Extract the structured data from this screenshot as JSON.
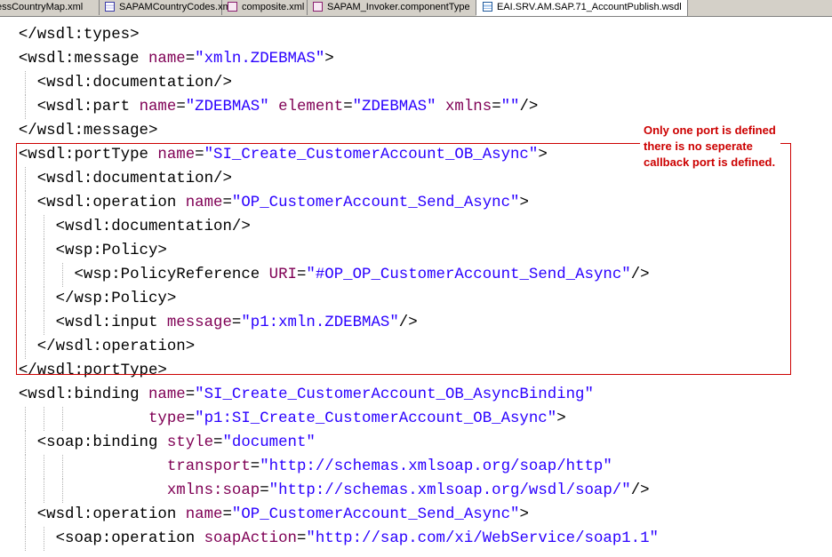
{
  "tabs": [
    {
      "label": "essCountryMap.xml",
      "icon": "xml-file-icon"
    },
    {
      "label": "SAPAMCountryCodes.xml",
      "icon": "xml-file-icon"
    },
    {
      "label": "composite.xml",
      "icon": "composite-file-icon"
    },
    {
      "label": "SAPAM_Invoker.componentType",
      "icon": "component-file-icon"
    },
    {
      "label": "EAI.SRV.AM.SAP.71_AccountPublish.wsdl",
      "icon": "wsdl-file-icon",
      "active": true
    }
  ],
  "annotation": {
    "text": "Only one port is defined there is no seperate callback port is defined.",
    "color": "#cc0000"
  },
  "code_lines": [
    {
      "indent": "  ",
      "segments": [
        [
          "t",
          "</wsdl:types>"
        ]
      ]
    },
    {
      "indent": "  ",
      "segments": [
        [
          "t",
          "<wsdl:message "
        ],
        [
          "n",
          "name"
        ],
        [
          "t",
          "="
        ],
        [
          "v",
          "\"xmln.ZDEBMAS\""
        ],
        [
          "t",
          ">"
        ]
      ]
    },
    {
      "indent": "    ",
      "segments": [
        [
          "t",
          "<wsdl:documentation/>"
        ]
      ]
    },
    {
      "indent": "    ",
      "segments": [
        [
          "t",
          "<wsdl:part "
        ],
        [
          "n",
          "name"
        ],
        [
          "t",
          "="
        ],
        [
          "v",
          "\"ZDEBMAS\""
        ],
        [
          "t",
          " "
        ],
        [
          "n",
          "element"
        ],
        [
          "t",
          "="
        ],
        [
          "v",
          "\"ZDEBMAS\""
        ],
        [
          "t",
          " "
        ],
        [
          "n",
          "xmlns"
        ],
        [
          "t",
          "="
        ],
        [
          "v",
          "\"\""
        ],
        [
          "t",
          "/>"
        ]
      ]
    },
    {
      "indent": "  ",
      "segments": [
        [
          "t",
          "</wsdl:message>"
        ]
      ]
    },
    {
      "indent": "  ",
      "segments": [
        [
          "t",
          "<wsdl:portType "
        ],
        [
          "n",
          "name"
        ],
        [
          "t",
          "="
        ],
        [
          "v",
          "\"SI_Create_CustomerAccount_OB_Async\""
        ],
        [
          "t",
          ">"
        ]
      ]
    },
    {
      "indent": "    ",
      "segments": [
        [
          "t",
          "<wsdl:documentation/>"
        ]
      ]
    },
    {
      "indent": "    ",
      "segments": [
        [
          "t",
          "<wsdl:operation "
        ],
        [
          "n",
          "name"
        ],
        [
          "t",
          "="
        ],
        [
          "v",
          "\"OP_CustomerAccount_Send_Async\""
        ],
        [
          "t",
          ">"
        ]
      ]
    },
    {
      "indent": "      ",
      "segments": [
        [
          "t",
          "<wsdl:documentation/>"
        ]
      ]
    },
    {
      "indent": "      ",
      "segments": [
        [
          "t",
          "<wsp:Policy>"
        ]
      ]
    },
    {
      "indent": "        ",
      "segments": [
        [
          "t",
          "<wsp:PolicyReference "
        ],
        [
          "n",
          "URI"
        ],
        [
          "t",
          "="
        ],
        [
          "v",
          "\"#OP_OP_CustomerAccount_Send_Async\""
        ],
        [
          "t",
          "/>"
        ]
      ]
    },
    {
      "indent": "      ",
      "segments": [
        [
          "t",
          "</wsp:Policy>"
        ]
      ]
    },
    {
      "indent": "      ",
      "segments": [
        [
          "t",
          "<wsdl:input "
        ],
        [
          "n",
          "message"
        ],
        [
          "t",
          "="
        ],
        [
          "v",
          "\"p1:xmln.ZDEBMAS\""
        ],
        [
          "t",
          "/>"
        ]
      ]
    },
    {
      "indent": "    ",
      "segments": [
        [
          "t",
          "</wsdl:operation>"
        ]
      ]
    },
    {
      "indent": "  ",
      "segments": [
        [
          "t",
          "</wsdl:portType>"
        ]
      ]
    },
    {
      "indent": "  ",
      "segments": [
        [
          "t",
          "<wsdl:binding "
        ],
        [
          "n",
          "name"
        ],
        [
          "t",
          "="
        ],
        [
          "v",
          "\"SI_Create_CustomerAccount_OB_AsyncBinding\""
        ]
      ]
    },
    {
      "indent": "                ",
      "segments": [
        [
          "n",
          "type"
        ],
        [
          "t",
          "="
        ],
        [
          "v",
          "\"p1:SI_Create_CustomerAccount_OB_Async\""
        ],
        [
          "t",
          ">"
        ]
      ]
    },
    {
      "indent": "    ",
      "segments": [
        [
          "t",
          "<soap:binding "
        ],
        [
          "n",
          "style"
        ],
        [
          "t",
          "="
        ],
        [
          "v",
          "\"document\""
        ]
      ]
    },
    {
      "indent": "                  ",
      "segments": [
        [
          "n",
          "transport"
        ],
        [
          "t",
          "="
        ],
        [
          "v",
          "\"http://schemas.xmlsoap.org/soap/http\""
        ]
      ]
    },
    {
      "indent": "                  ",
      "segments": [
        [
          "n",
          "xmlns:soap"
        ],
        [
          "t",
          "="
        ],
        [
          "v",
          "\"http://schemas.xmlsoap.org/wsdl/soap/\""
        ],
        [
          "t",
          "/>"
        ]
      ]
    },
    {
      "indent": "    ",
      "segments": [
        [
          "t",
          "<wsdl:operation "
        ],
        [
          "n",
          "name"
        ],
        [
          "t",
          "="
        ],
        [
          "v",
          "\"OP_CustomerAccount_Send_Async\""
        ],
        [
          "t",
          ">"
        ]
      ]
    },
    {
      "indent": "      ",
      "segments": [
        [
          "t",
          "<soap:operation "
        ],
        [
          "n",
          "soapAction"
        ],
        [
          "t",
          "="
        ],
        [
          "v",
          "\"http://sap.com/xi/WebService/soap1.1\""
        ]
      ]
    }
  ]
}
